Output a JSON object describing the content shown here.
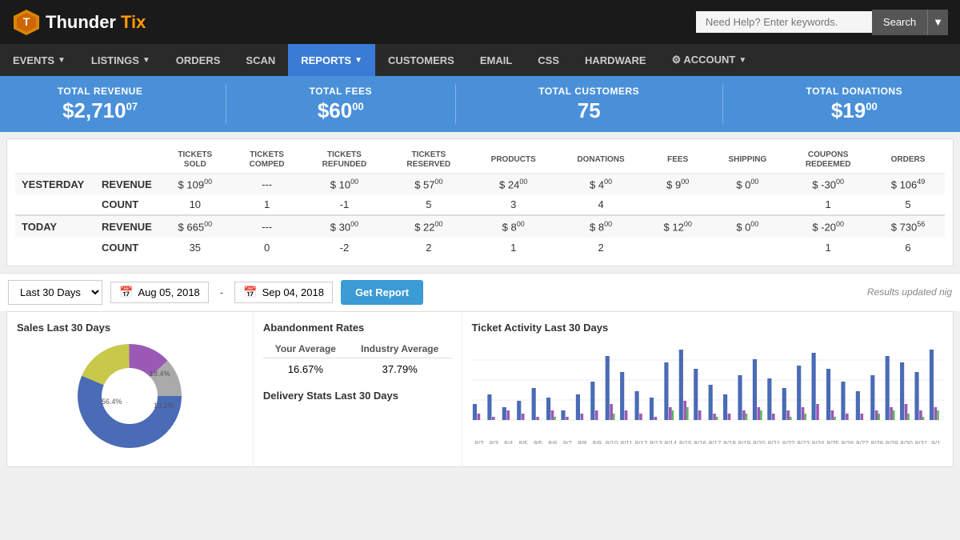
{
  "header": {
    "logo_thunder": "Thunder",
    "logo_tix": "Tix",
    "search_placeholder": "Need Help? Enter keywords.",
    "search_btn": "Search"
  },
  "nav": {
    "items": [
      {
        "label": "EVENTS",
        "arrow": true,
        "active": false
      },
      {
        "label": "LISTINGS",
        "arrow": true,
        "active": false
      },
      {
        "label": "ORDERS",
        "arrow": false,
        "active": false
      },
      {
        "label": "SCAN",
        "arrow": false,
        "active": false
      },
      {
        "label": "REPORTS",
        "arrow": true,
        "active": true
      },
      {
        "label": "CUSTOMERS",
        "arrow": false,
        "active": false
      },
      {
        "label": "EMAIL",
        "arrow": false,
        "active": false
      },
      {
        "label": "CSS",
        "arrow": false,
        "active": false
      },
      {
        "label": "HARDWARE",
        "arrow": false,
        "active": false
      },
      {
        "label": "⚙ ACCOUNT",
        "arrow": true,
        "active": false
      }
    ]
  },
  "stats": [
    {
      "label": "TOTAL REVENUE",
      "value": "$2,710",
      "sup": "07"
    },
    {
      "label": "TOTAL FEES",
      "value": "$60",
      "sup": "00"
    },
    {
      "label": "TOTAL CUSTOMERS",
      "value": "75",
      "sup": ""
    },
    {
      "label": "TOTAL DONATIONS",
      "value": "$19",
      "sup": "00"
    }
  ],
  "table": {
    "headers": [
      "",
      "",
      "TICKETS SOLD",
      "TICKETS COMPED",
      "TICKETS REFUNDED",
      "TICKETS RESERVED",
      "PRODUCTS",
      "DONATIONS",
      "FEES",
      "SHIPPING",
      "COUPONS REDEEMED",
      "ORDERS"
    ],
    "rows": [
      {
        "group": "YESTERDAY",
        "revenue_row": {
          "sublabel": "REVENUE",
          "cells": [
            "$109",
            "---",
            "$10",
            "$57",
            "$24",
            "$4",
            "$9",
            "$0",
            "$-30",
            "$106"
          ],
          "sups": [
            "00",
            "",
            "00",
            "00",
            "00",
            "00",
            "00",
            "00",
            "00",
            "49"
          ]
        },
        "count_row": {
          "sublabel": "COUNT",
          "cells": [
            "10",
            "1",
            "-1",
            "5",
            "3",
            "4",
            "",
            "",
            "1",
            "5"
          ]
        }
      },
      {
        "group": "TODAY",
        "revenue_row": {
          "sublabel": "REVENUE",
          "cells": [
            "$665",
            "---",
            "$30",
            "$22",
            "$8",
            "$8",
            "$12",
            "$0",
            "$-20",
            "$730"
          ],
          "sups": [
            "00",
            "",
            "00",
            "00",
            "00",
            "00",
            "00",
            "00",
            "00",
            "56"
          ]
        },
        "count_row": {
          "sublabel": "COUNT",
          "cells": [
            "35",
            "0",
            "-2",
            "2",
            "1",
            "2",
            "",
            "",
            "1",
            "6"
          ]
        }
      }
    ]
  },
  "controls": {
    "date_range": "Last 30 Days",
    "date_from": "Aug 05, 2018",
    "date_to": "Sep 04, 2018",
    "get_report_btn": "Get Report",
    "updated_note": "Results updated nig"
  },
  "abandonment": {
    "title": "Abandonment Rates",
    "col1": "Your Average",
    "col2": "Industry Average",
    "your_avg": "16.67%",
    "industry_avg": "37.79%"
  },
  "delivery": {
    "title": "Delivery Stats Last 30 Days"
  },
  "sales_chart": {
    "title": "Sales Last 30 Days",
    "segments": [
      {
        "color": "#4a6bb5",
        "pct": 56.4,
        "label": "56.4%"
      },
      {
        "color": "#c8c84a",
        "pct": 18.4,
        "label": "18.4%"
      },
      {
        "color": "#9b59b6",
        "pct": 13.2,
        "label": "13.2%"
      },
      {
        "color": "#aaaaaa",
        "pct": 12.0,
        "label": ""
      }
    ]
  },
  "ticket_activity": {
    "title": "Ticket Activity Last 30 Days",
    "x_labels": [
      "8/2",
      "8/3",
      "8/4",
      "8/5",
      "8/5",
      "8/6",
      "8/7",
      "8/8",
      "8/9",
      "8/10",
      "8/11",
      "8/12",
      "8/13",
      "8/14",
      "8/15",
      "8/16",
      "8/17",
      "8/18",
      "8/19",
      "8/20",
      "8/21",
      "8/22",
      "8/23",
      "8/24",
      "8/25",
      "8/26",
      "8/27",
      "8/28",
      "8/29",
      "8/30",
      "8/31",
      "9/1"
    ],
    "bars": [
      {
        "blue": 5,
        "purple": 2,
        "green": 0
      },
      {
        "blue": 8,
        "purple": 1,
        "green": 0
      },
      {
        "blue": 4,
        "purple": 3,
        "green": 0
      },
      {
        "blue": 6,
        "purple": 2,
        "green": 0
      },
      {
        "blue": 10,
        "purple": 1,
        "green": 0
      },
      {
        "blue": 7,
        "purple": 3,
        "green": 1
      },
      {
        "blue": 3,
        "purple": 1,
        "green": 0
      },
      {
        "blue": 8,
        "purple": 2,
        "green": 0
      },
      {
        "blue": 12,
        "purple": 3,
        "green": 0
      },
      {
        "blue": 20,
        "purple": 5,
        "green": 2
      },
      {
        "blue": 15,
        "purple": 3,
        "green": 0
      },
      {
        "blue": 9,
        "purple": 2,
        "green": 0
      },
      {
        "blue": 7,
        "purple": 1,
        "green": 0
      },
      {
        "blue": 18,
        "purple": 4,
        "green": 3
      },
      {
        "blue": 22,
        "purple": 6,
        "green": 4
      },
      {
        "blue": 16,
        "purple": 3,
        "green": 0
      },
      {
        "blue": 11,
        "purple": 2,
        "green": 1
      },
      {
        "blue": 8,
        "purple": 2,
        "green": 0
      },
      {
        "blue": 14,
        "purple": 3,
        "green": 2
      },
      {
        "blue": 19,
        "purple": 4,
        "green": 3
      },
      {
        "blue": 13,
        "purple": 2,
        "green": 0
      },
      {
        "blue": 10,
        "purple": 3,
        "green": 1
      },
      {
        "blue": 17,
        "purple": 4,
        "green": 2
      },
      {
        "blue": 21,
        "purple": 5,
        "green": 0
      },
      {
        "blue": 16,
        "purple": 3,
        "green": 1
      },
      {
        "blue": 12,
        "purple": 2,
        "green": 0
      },
      {
        "blue": 9,
        "purple": 2,
        "green": 0
      },
      {
        "blue": 14,
        "purple": 3,
        "green": 2
      },
      {
        "blue": 20,
        "purple": 4,
        "green": 3
      },
      {
        "blue": 18,
        "purple": 5,
        "green": 2
      },
      {
        "blue": 15,
        "purple": 3,
        "green": 1
      },
      {
        "blue": 22,
        "purple": 4,
        "green": 3
      }
    ]
  }
}
